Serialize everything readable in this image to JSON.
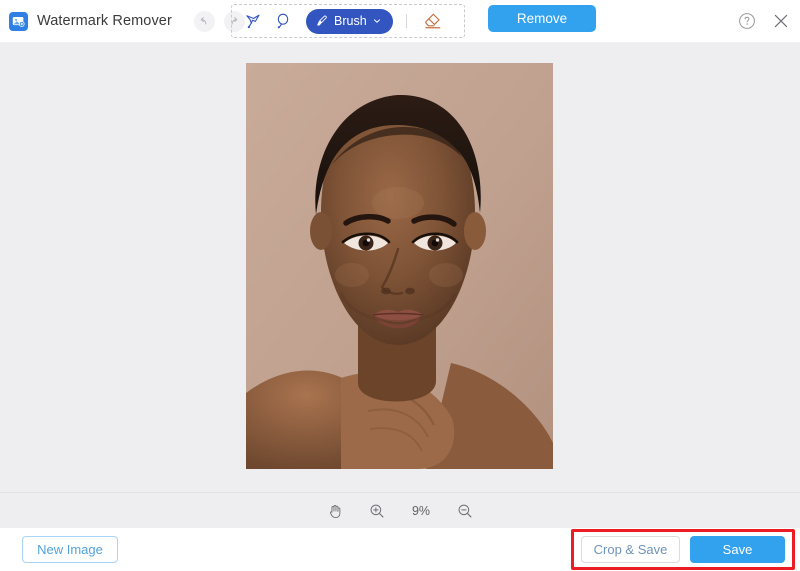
{
  "app": {
    "title": "Watermark Remover",
    "logo_icon": "image-logo-icon"
  },
  "header": {
    "undo_icon": "undo-arrow-icon",
    "redo_icon": "redo-arrow-icon",
    "tools": [
      {
        "name": "polygonal-lasso-tool",
        "icon": "polygonal-lasso-icon"
      },
      {
        "name": "lasso-tool",
        "icon": "lasso-icon"
      }
    ],
    "brush": {
      "label": "Brush",
      "icon": "brush-icon",
      "chevron_icon": "chevron-down-icon",
      "active_color": "#3355c0"
    },
    "eraser": {
      "name": "eraser-tool",
      "icon": "eraser-icon",
      "color": "#c4703f"
    },
    "remove_label": "Remove",
    "remove_color": "#32a2ef",
    "help_icon": "help-circle-icon",
    "close_icon": "close-icon"
  },
  "canvas": {
    "background": "#eeeef0",
    "image_alt": "Portrait photo of a woman resting her chin on her hand"
  },
  "zoombar": {
    "hand_icon": "hand-tool-icon",
    "zoom_in_icon": "zoom-in-icon",
    "zoom_out_icon": "zoom-out-icon",
    "zoom_level": "9%"
  },
  "footer": {
    "new_image_label": "New Image",
    "crop_save_label": "Crop & Save",
    "save_label": "Save",
    "save_color": "#32a2ef",
    "highlight_color": "#ed1c24"
  }
}
